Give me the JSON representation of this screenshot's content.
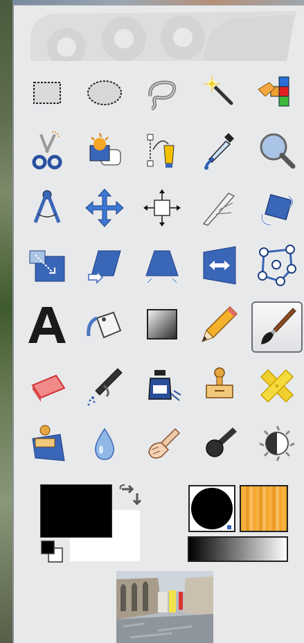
{
  "window": {
    "title": ""
  },
  "toolbox": {
    "tools": [
      {
        "name": "rect-select-icon"
      },
      {
        "name": "ellipse-select-icon"
      },
      {
        "name": "free-select-icon"
      },
      {
        "name": "fuzzy-select-icon"
      },
      {
        "name": "select-by-color-icon"
      },
      {
        "name": "scissors-select-icon"
      },
      {
        "name": "foreground-select-icon"
      },
      {
        "name": "paths-icon"
      },
      {
        "name": "color-picker-icon"
      },
      {
        "name": "zoom-icon"
      },
      {
        "name": "measure-icon"
      },
      {
        "name": "move-icon"
      },
      {
        "name": "align-icon"
      },
      {
        "name": "crop-icon"
      },
      {
        "name": "rotate-icon"
      },
      {
        "name": "scale-icon"
      },
      {
        "name": "shear-icon"
      },
      {
        "name": "perspective-icon"
      },
      {
        "name": "flip-icon"
      },
      {
        "name": "cage-transform-icon"
      },
      {
        "name": "text-icon"
      },
      {
        "name": "bucket-fill-icon"
      },
      {
        "name": "blend-icon"
      },
      {
        "name": "pencil-icon"
      },
      {
        "name": "paintbrush-icon",
        "active": true
      },
      {
        "name": "eraser-icon"
      },
      {
        "name": "airbrush-icon"
      },
      {
        "name": "ink-icon"
      },
      {
        "name": "clone-icon"
      },
      {
        "name": "heal-icon"
      },
      {
        "name": "perspective-clone-icon"
      },
      {
        "name": "blur-sharpen-icon"
      },
      {
        "name": "smudge-icon"
      },
      {
        "name": "dodge-burn-icon"
      },
      {
        "name": "desaturate-icon"
      }
    ]
  },
  "colors": {
    "foreground": "#000000",
    "background": "#ffffff",
    "accent_active_border": "#6b6e73"
  },
  "brush": {
    "name": "brush-preview"
  },
  "pattern": {
    "name": "pattern-preview",
    "color": "#f5a623"
  },
  "gradient": {
    "name": "gradient-preview",
    "start": "#000000",
    "end": "#ffffff"
  },
  "image": {
    "name": "active-image-thumbnail"
  }
}
